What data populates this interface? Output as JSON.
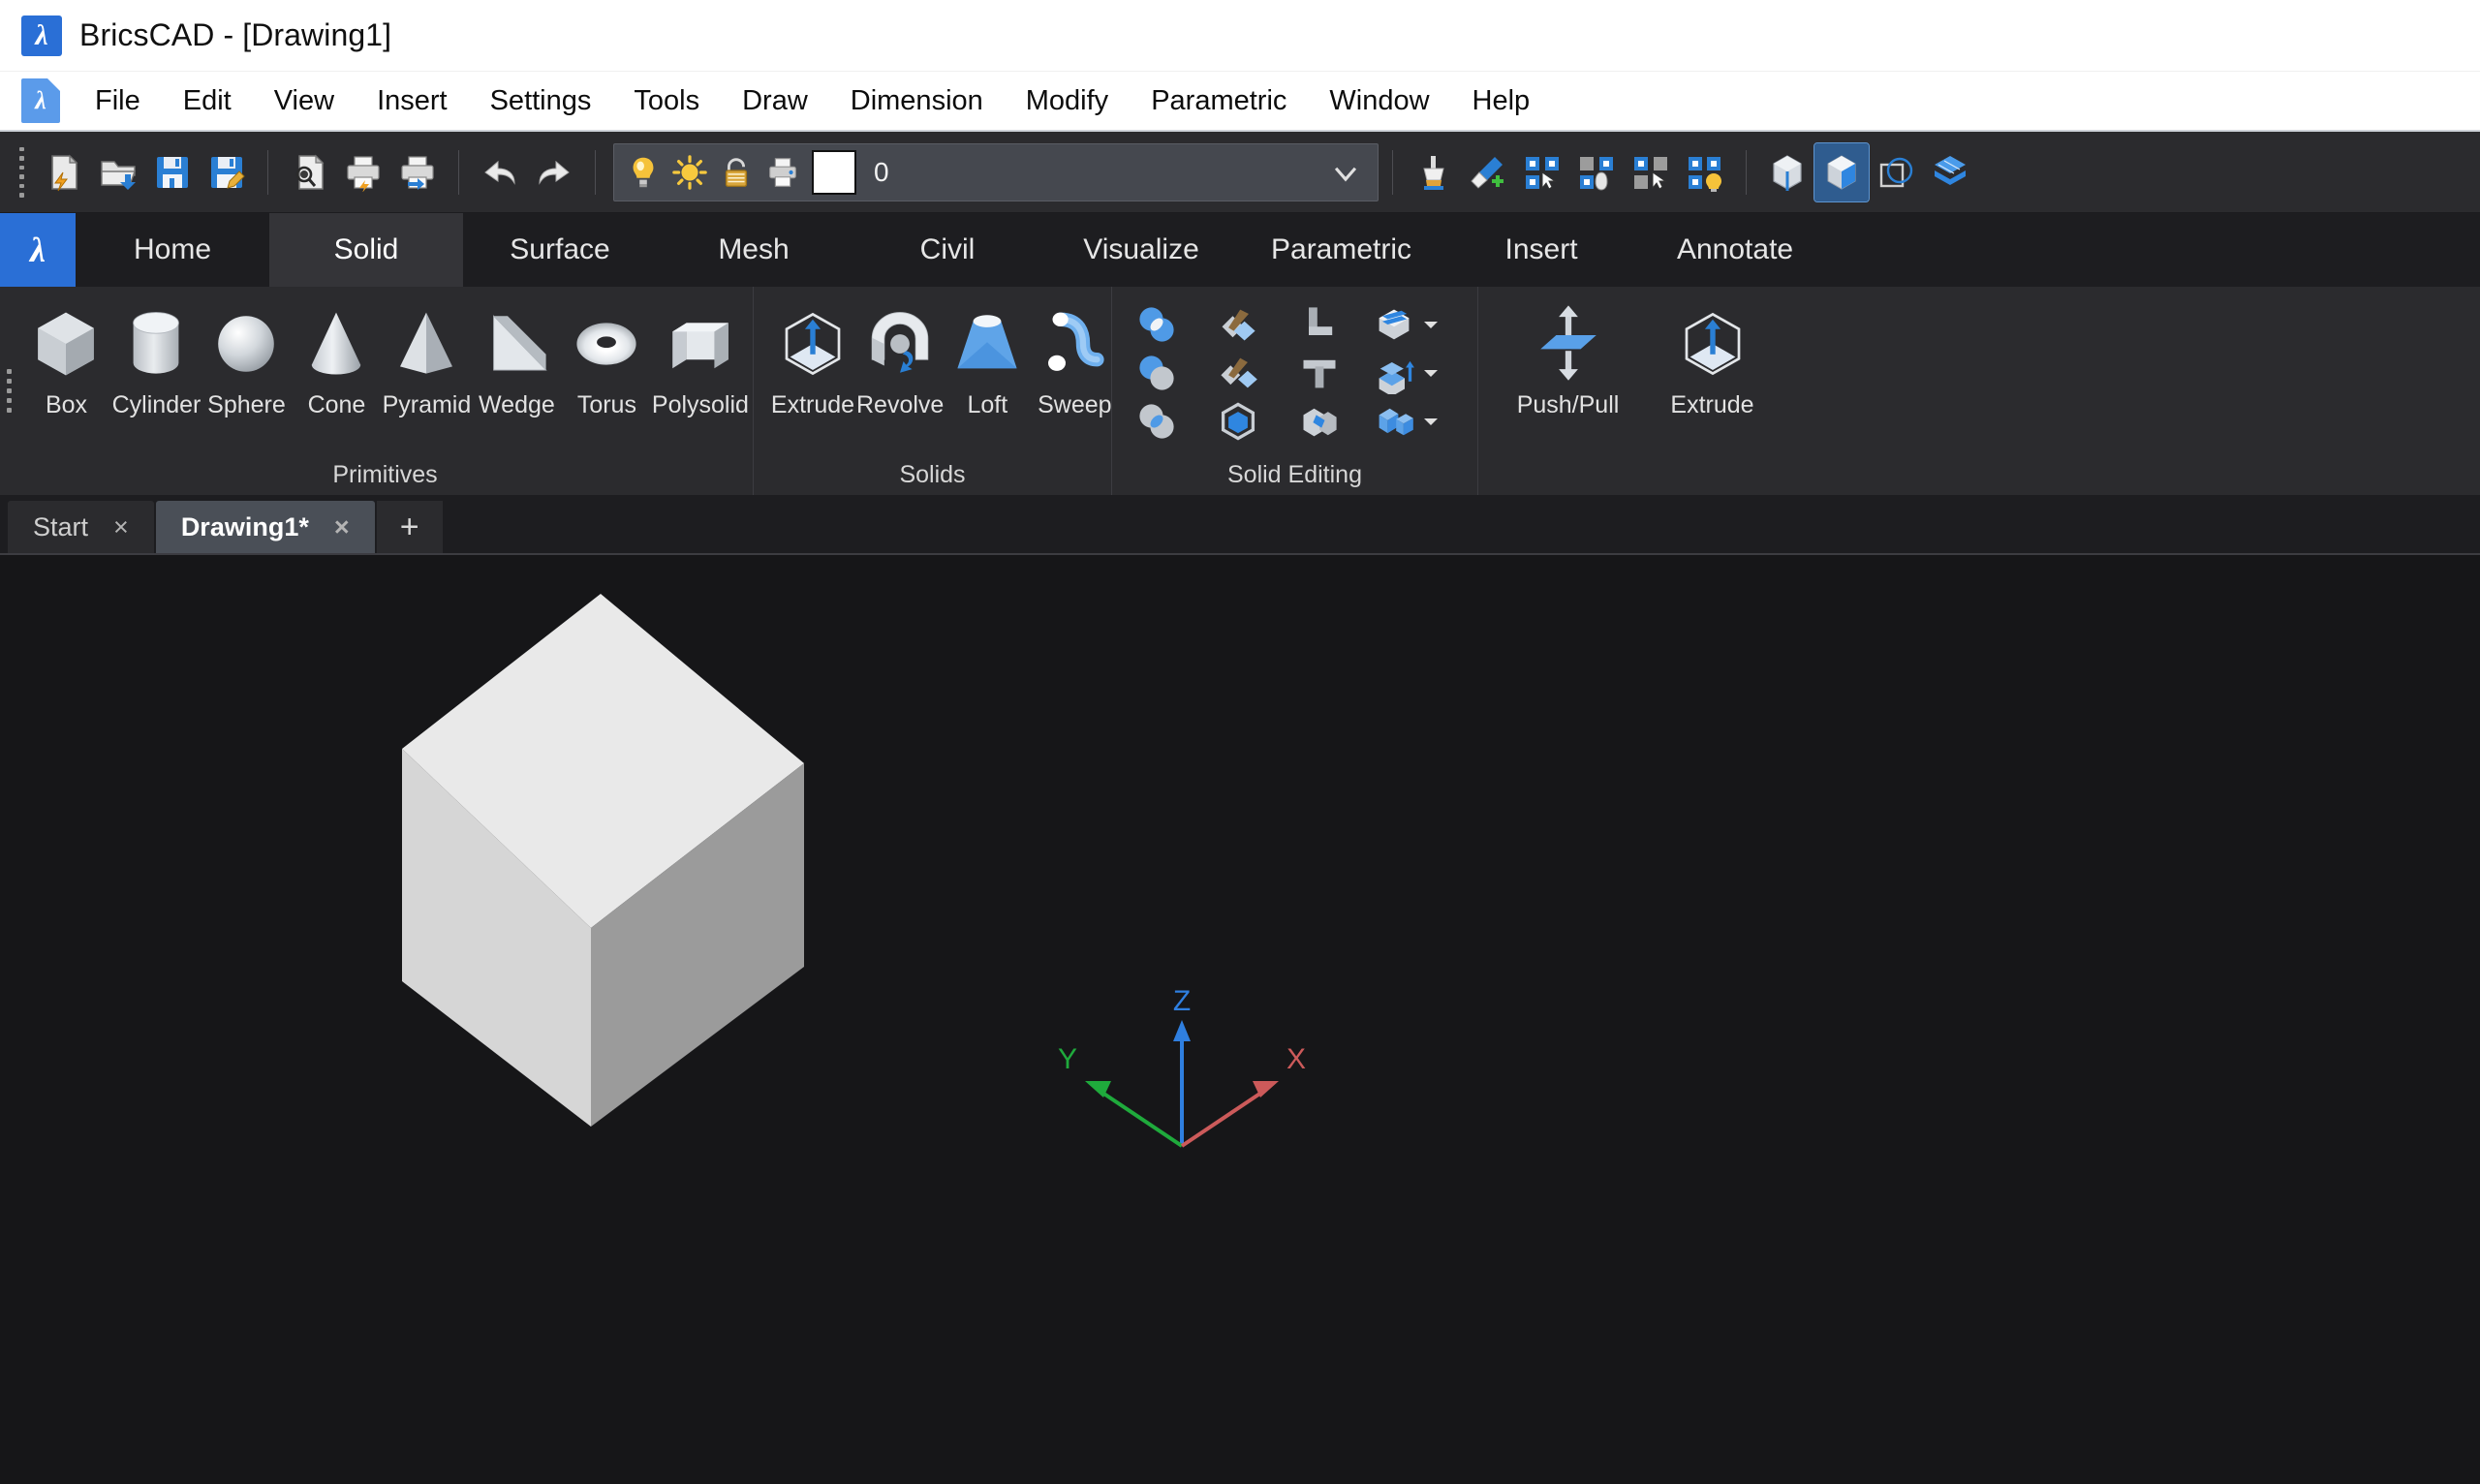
{
  "window": {
    "title": "BricsCAD - [Drawing1]",
    "logo_glyph": "λ"
  },
  "menubar": {
    "items": [
      {
        "label": "File"
      },
      {
        "label": "Edit"
      },
      {
        "label": "View"
      },
      {
        "label": "Insert"
      },
      {
        "label": "Settings"
      },
      {
        "label": "Tools"
      },
      {
        "label": "Draw"
      },
      {
        "label": "Dimension"
      },
      {
        "label": "Modify"
      },
      {
        "label": "Parametric"
      },
      {
        "label": "Window"
      },
      {
        "label": "Help"
      }
    ]
  },
  "toolbar": {
    "buttons": [
      {
        "name": "new-drawing-icon",
        "tip": "New"
      },
      {
        "name": "open-drawing-icon",
        "tip": "Open"
      },
      {
        "name": "save-icon",
        "tip": "Save"
      },
      {
        "name": "save-as-icon",
        "tip": "Save As"
      },
      {
        "name": "print-preview-icon",
        "tip": "Print Preview"
      },
      {
        "name": "print-icon",
        "tip": "Print"
      },
      {
        "name": "plot-icon",
        "tip": "Plot"
      },
      {
        "name": "undo-icon",
        "tip": "Undo"
      },
      {
        "name": "redo-icon",
        "tip": "Redo"
      }
    ],
    "right_buttons": [
      {
        "name": "clean-screen-icon",
        "tip": "Clean"
      },
      {
        "name": "match-properties-icon",
        "tip": "Match Properties"
      },
      {
        "name": "select-all-icon",
        "tip": "Select All"
      },
      {
        "name": "select-similar-icon",
        "tip": "Select Similar"
      },
      {
        "name": "invert-selection-icon",
        "tip": "Invert Selection"
      },
      {
        "name": "select-by-layer-icon",
        "tip": "Select by Layer"
      },
      {
        "name": "visual-style-wireframe-icon",
        "tip": "Wireframe"
      },
      {
        "name": "visual-style-shaded-icon",
        "tip": "Shaded"
      },
      {
        "name": "visual-style-hidden-icon",
        "tip": "Hidden"
      },
      {
        "name": "visual-style-realistic-icon",
        "tip": "Realistic"
      }
    ]
  },
  "layer_control": {
    "icons": [
      "lightbulb-on-icon",
      "sun-freeze-icon",
      "lock-unlocked-icon",
      "plot-layer-icon"
    ],
    "color_swatch": "#ffffff",
    "layer_name": "0",
    "dropdown": "chevron-down-icon"
  },
  "ribbon": {
    "tabs": [
      {
        "label": "Home",
        "active": false
      },
      {
        "label": "Solid",
        "active": true
      },
      {
        "label": "Surface",
        "active": false
      },
      {
        "label": "Mesh",
        "active": false
      },
      {
        "label": "Civil",
        "active": false
      },
      {
        "label": "Visualize",
        "active": false
      },
      {
        "label": "Parametric",
        "active": false
      },
      {
        "label": "Insert",
        "active": false
      },
      {
        "label": "Annotate",
        "active": false
      }
    ],
    "panels": [
      {
        "label": "Primitives",
        "buttons": [
          {
            "label": "Box",
            "icon": "box-solid-icon"
          },
          {
            "label": "Cylinder",
            "icon": "cylinder-solid-icon"
          },
          {
            "label": "Sphere",
            "icon": "sphere-solid-icon"
          },
          {
            "label": "Cone",
            "icon": "cone-solid-icon"
          },
          {
            "label": "Pyramid",
            "icon": "pyramid-solid-icon"
          },
          {
            "label": "Wedge",
            "icon": "wedge-solid-icon"
          },
          {
            "label": "Torus",
            "icon": "torus-solid-icon"
          },
          {
            "label": "Polysolid",
            "icon": "polysolid-icon"
          }
        ]
      },
      {
        "label": "Solids",
        "buttons": [
          {
            "label": "Extrude",
            "icon": "extrude-icon"
          },
          {
            "label": "Revolve",
            "icon": "revolve-icon"
          },
          {
            "label": "Loft",
            "icon": "loft-icon"
          },
          {
            "label": "Sweep",
            "icon": "sweep-icon"
          }
        ]
      },
      {
        "label": "Solid Editing",
        "small_buttons": [
          {
            "icon": "union-icon",
            "dropdown": false
          },
          {
            "icon": "slice-icon",
            "dropdown": false
          },
          {
            "icon": "corner-l-icon",
            "dropdown": false
          },
          {
            "icon": "shell-icon",
            "dropdown": true
          },
          {
            "icon": "subtract-icon",
            "dropdown": false
          },
          {
            "icon": "slice-solid-icon",
            "dropdown": false
          },
          {
            "icon": "tee-junction-icon",
            "dropdown": false
          },
          {
            "icon": "offset-face-icon",
            "dropdown": true
          },
          {
            "icon": "intersect-icon",
            "dropdown": false
          },
          {
            "icon": "interfere-icon",
            "dropdown": false
          },
          {
            "icon": "imprint-icon",
            "dropdown": false
          },
          {
            "icon": "separate-solids-icon",
            "dropdown": true
          }
        ]
      },
      {
        "label": "",
        "buttons": [
          {
            "label": "Push/Pull",
            "icon": "push-pull-icon"
          },
          {
            "label": "Extrude",
            "icon": "extrude-face-icon"
          }
        ]
      }
    ]
  },
  "document_tabs": {
    "tabs": [
      {
        "label": "Start",
        "active": false,
        "close": "×"
      },
      {
        "label": "Drawing1*",
        "active": true,
        "close": "×"
      }
    ],
    "add_label": "+"
  },
  "viewport": {
    "background": "#161618",
    "ucs": {
      "x_label": "X",
      "y_label": "Y",
      "z_label": "Z",
      "x_color": "#cc5a5a",
      "y_color": "#1faa3c",
      "z_color": "#2f7fe0"
    },
    "solid": {
      "name": "3d-box-solid",
      "top_color": "#e9e9e9",
      "left_color": "#d6d6d6",
      "right_color": "#9b9b9b"
    }
  }
}
